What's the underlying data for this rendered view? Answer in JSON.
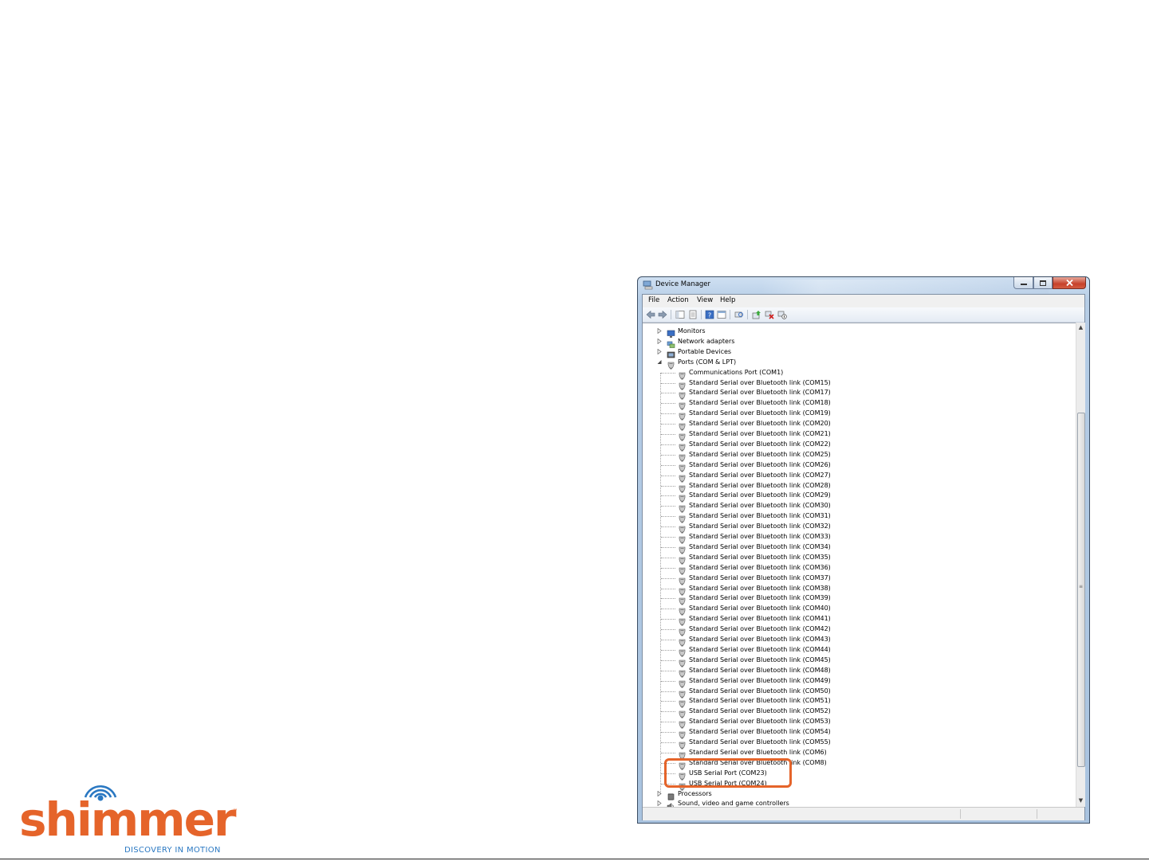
{
  "window": {
    "title": "Device Manager",
    "menu": [
      "File",
      "Action",
      "View",
      "Help"
    ]
  },
  "tree": {
    "categories_top": [
      {
        "label": "Monitors",
        "icon": "monitor-icon",
        "expanded": false
      },
      {
        "label": "Network adapters",
        "icon": "network-adapter-icon",
        "expanded": false
      },
      {
        "label": "Portable Devices",
        "icon": "portable-device-icon",
        "expanded": false
      },
      {
        "label": "Ports (COM & LPT)",
        "icon": "port-icon",
        "expanded": true
      }
    ],
    "ports": [
      "Communications Port (COM1)",
      "Standard Serial over Bluetooth link (COM15)",
      "Standard Serial over Bluetooth link (COM17)",
      "Standard Serial over Bluetooth link (COM18)",
      "Standard Serial over Bluetooth link (COM19)",
      "Standard Serial over Bluetooth link (COM20)",
      "Standard Serial over Bluetooth link (COM21)",
      "Standard Serial over Bluetooth link (COM22)",
      "Standard Serial over Bluetooth link (COM25)",
      "Standard Serial over Bluetooth link (COM26)",
      "Standard Serial over Bluetooth link (COM27)",
      "Standard Serial over Bluetooth link (COM28)",
      "Standard Serial over Bluetooth link (COM29)",
      "Standard Serial over Bluetooth link (COM30)",
      "Standard Serial over Bluetooth link (COM31)",
      "Standard Serial over Bluetooth link (COM32)",
      "Standard Serial over Bluetooth link (COM33)",
      "Standard Serial over Bluetooth link (COM34)",
      "Standard Serial over Bluetooth link (COM35)",
      "Standard Serial over Bluetooth link (COM36)",
      "Standard Serial over Bluetooth link (COM37)",
      "Standard Serial over Bluetooth link (COM38)",
      "Standard Serial over Bluetooth link (COM39)",
      "Standard Serial over Bluetooth link (COM40)",
      "Standard Serial over Bluetooth link (COM41)",
      "Standard Serial over Bluetooth link (COM42)",
      "Standard Serial over Bluetooth link (COM43)",
      "Standard Serial over Bluetooth link (COM44)",
      "Standard Serial over Bluetooth link (COM45)",
      "Standard Serial over Bluetooth link (COM48)",
      "Standard Serial over Bluetooth link (COM49)",
      "Standard Serial over Bluetooth link (COM50)",
      "Standard Serial over Bluetooth link (COM51)",
      "Standard Serial over Bluetooth link (COM52)",
      "Standard Serial over Bluetooth link (COM53)",
      "Standard Serial over Bluetooth link (COM54)",
      "Standard Serial over Bluetooth link (COM55)",
      "Standard Serial over Bluetooth link (COM6)",
      "Standard Serial over Bluetooth link (COM8)",
      "USB Serial Port (COM23)",
      "USB Serial Port (COM24)"
    ],
    "categories_bottom": [
      {
        "label": "Processors",
        "icon": "processor-icon",
        "expanded": false
      },
      {
        "label": "Sound, video and game controllers",
        "icon": "sound-icon",
        "expanded": false
      }
    ]
  },
  "logo": {
    "wordmark": "shimmer",
    "tagline": "DISCOVERY IN MOTION",
    "tm": "™"
  },
  "colors": {
    "brand_orange": "#e5642a",
    "brand_blue": "#2a78c2",
    "highlight_box": "#e5642a"
  }
}
